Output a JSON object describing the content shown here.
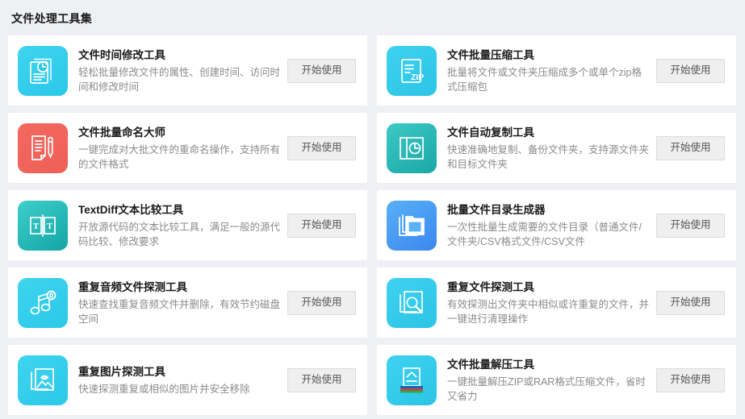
{
  "page": {
    "title": "文件处理工具集",
    "background_color": "#eef0f3",
    "card_background": "#ffffff"
  },
  "cards": [
    {
      "title": "文件时间修改工具",
      "desc": "轻松批量修改文件的属性、创建时间、访问时间和修改时间",
      "action": "开始使用",
      "icon": "document-clock-icon",
      "icon_color": "#2bc8e8"
    },
    {
      "title": "文件批量压缩工具",
      "desc": "批量将文件或文件夹压缩成多个或单个zip格式压缩包",
      "action": "开始使用",
      "icon": "zip-file-icon",
      "icon_color": "#2cc4e6"
    },
    {
      "title": "文件批量命名大师",
      "desc": "一键完成对大批文件的重命名操作，支持所有的文件格式",
      "action": "开始使用",
      "icon": "document-pencil-icon",
      "icon_color": "#ee6057"
    },
    {
      "title": "文件自动复制工具",
      "desc": "快速准确地复制、备份文件夹，支持源文件夹和目标文件夹",
      "action": "开始使用",
      "icon": "copy-clock-icon",
      "icon_color": "#1aa8a6"
    },
    {
      "title": "TextDiff文本比较工具",
      "desc": "开放源代码的文本比较工具，满足一般的源代码比较、修改要求",
      "action": "开始使用",
      "icon": "text-diff-icon",
      "icon_color": "#13a5a5"
    },
    {
      "title": "批量文件目录生成器",
      "desc": "一次性批量生成需要的文件目录（普通文件/文件夹/CSV格式文件/CSV文件",
      "action": "开始使用",
      "icon": "folder-stack-icon",
      "icon_color": "#3b87f0"
    },
    {
      "title": "重复音频文件探测工具",
      "desc": "快速查找重复音频文件并删除，有效节约磁盘空间",
      "action": "开始使用",
      "icon": "music-note-icon",
      "icon_color": "#2bc8e8"
    },
    {
      "title": "重复文件探测工具",
      "desc": "有效探测出文件夹中相似或许重复的文件，并一键进行清理操作",
      "action": "开始使用",
      "icon": "file-search-icon",
      "icon_color": "#2cc4e6"
    },
    {
      "title": "重复图片探测工具",
      "desc": "快速探测重复或相似的图片并安全移除",
      "action": "开始使用",
      "icon": "image-search-icon",
      "icon_color": "#2bc8e8"
    },
    {
      "title": "文件批量解压工具",
      "desc": "一键批量解压ZIP或RAR格式压缩文件，省时又省力",
      "action": "开始使用",
      "icon": "unzip-icon",
      "icon_color": "#2cc4e6"
    }
  ]
}
